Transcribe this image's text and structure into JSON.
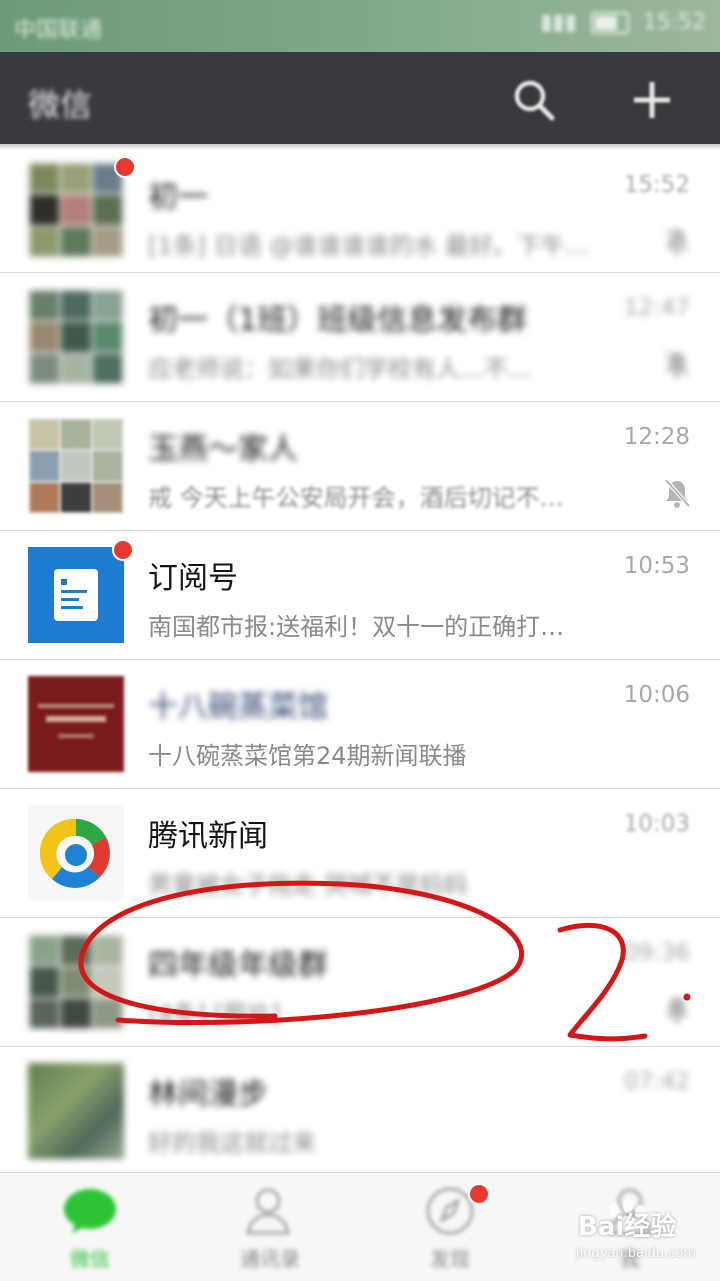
{
  "status_bar": {
    "carrier": "中国联通",
    "time": "15:52"
  },
  "header": {
    "title": "微信"
  },
  "chats": [
    {
      "name": "初一",
      "preview": "[1条] 日语 @谁谁谁谁的水 最好。下午…",
      "time": "15:52",
      "muted": true,
      "badge": true
    },
    {
      "name": "初一（1班）班级信息发布群",
      "preview": "应老师说：如果你们学校有人…不…",
      "time": "12:47",
      "muted": true,
      "badge": false
    },
    {
      "name": "玉燕～家人",
      "preview": "戒 今天上午公安局开会，酒后切记不…",
      "time": "12:28",
      "muted": true,
      "badge": false
    },
    {
      "name": "订阅号",
      "preview": "南国都市报:送福利！双十一的正确打…",
      "time": "10:53",
      "muted": false,
      "badge": true
    },
    {
      "name": "十八碗蒸菜馆",
      "preview": "十八碗蒸菜馆第24期新闻联播",
      "time": "10:06",
      "muted": false,
      "badge": false
    },
    {
      "name": "腾讯新闻",
      "preview": "男童被女子拖走 哭喊不是妈妈",
      "time": "10:03",
      "muted": false,
      "badge": false
    },
    {
      "name": "四年级年级群",
      "preview": "[4条] [图片]",
      "time": "09:36",
      "muted": true,
      "badge": false
    },
    {
      "name": "林间漫步",
      "preview": "好的我这就过来",
      "time": "07:42",
      "muted": false,
      "badge": false
    }
  ],
  "tabs": [
    {
      "label": "微信",
      "icon": "chat-bubble-icon",
      "badge": false
    },
    {
      "label": "通讯录",
      "icon": "contacts-icon",
      "badge": false
    },
    {
      "label": "发现",
      "icon": "compass-icon",
      "badge": true
    },
    {
      "label": "我",
      "icon": "person-icon",
      "badge": false
    }
  ],
  "annotation": {
    "label": "2."
  },
  "watermark": {
    "brand": "Bai经验",
    "url": "jingyan.baidu.com"
  },
  "colors": {
    "header": "#393a3f",
    "accent": "#2ec337",
    "badge": "#e63a2e",
    "annotation": "#d41616"
  }
}
